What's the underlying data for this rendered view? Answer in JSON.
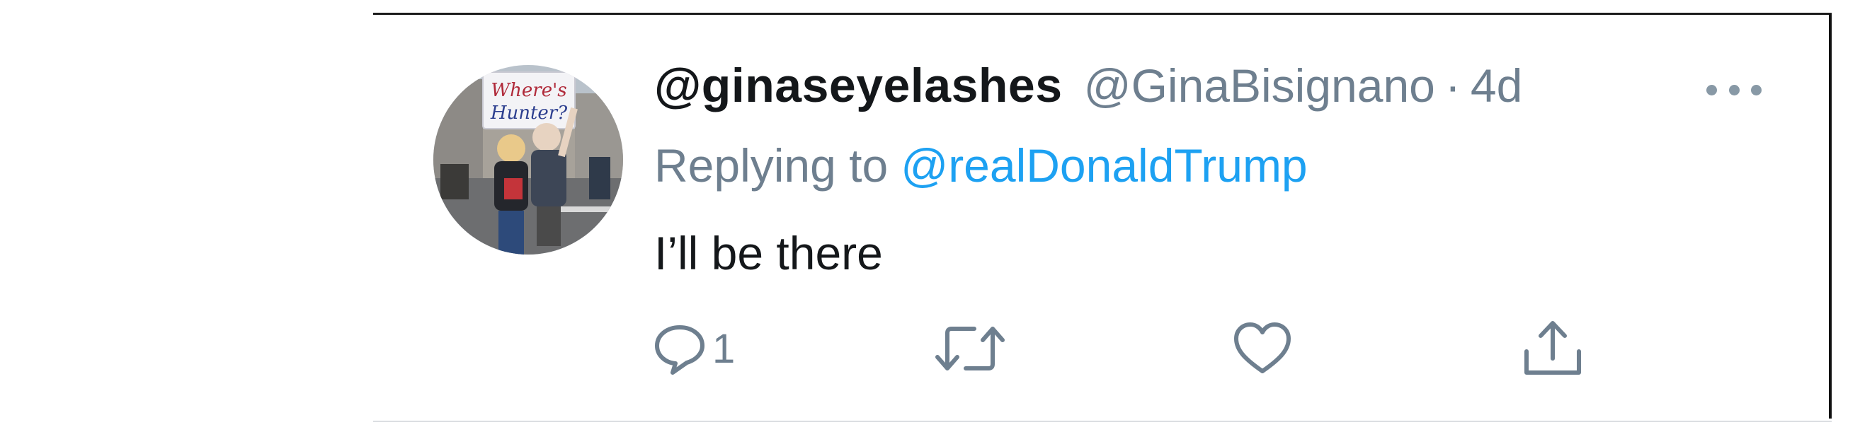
{
  "tweet": {
    "display_name": "@ginaseyelashes",
    "handle": "@GinaBisignano",
    "separator": "·",
    "time": "4d",
    "reply_prefix": "Replying to",
    "reply_target": "@realDonaldTrump",
    "text": "I’ll be there",
    "avatar_sign_text": "Where's Hunter?",
    "reply_count": "1"
  },
  "icons": {
    "more": "more-horizontal-icon",
    "reply": "reply-icon",
    "retweet": "retweet-icon",
    "like": "heart-icon",
    "share": "share-icon"
  },
  "colors": {
    "name": "#14171a",
    "secondary": "#6e7f8f",
    "link": "#1da1f2",
    "icon": "#6e7f8f"
  }
}
